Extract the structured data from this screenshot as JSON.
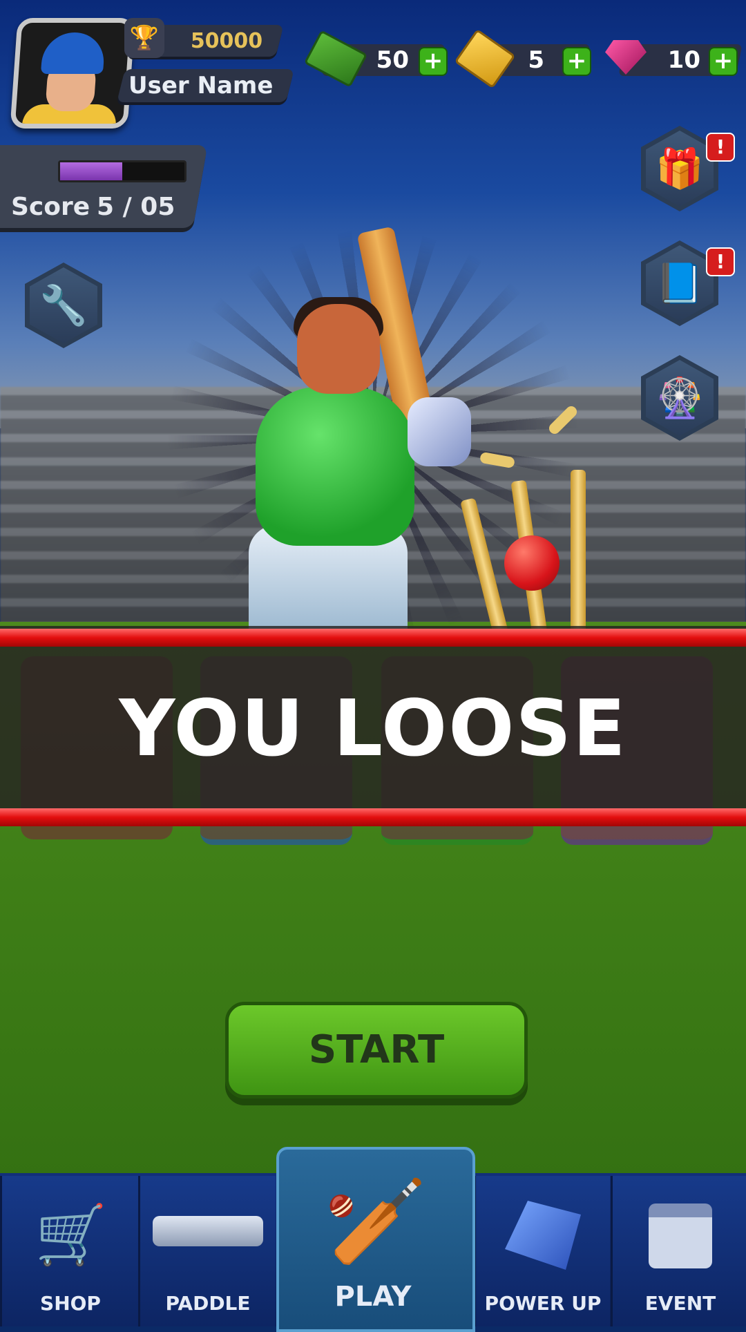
{
  "header": {
    "trophy_score": "50000",
    "user_name": "User Name"
  },
  "currencies": [
    {
      "name": "cash",
      "value": "50"
    },
    {
      "name": "tickets",
      "value": "5"
    },
    {
      "name": "gems",
      "value": "10"
    }
  ],
  "plus_symbol": "+",
  "score_panel": {
    "label": "Score",
    "value": "5 / 05",
    "progress_fraction": 0.5
  },
  "side_buttons": {
    "badge_text": "!"
  },
  "banner": {
    "text": "YOU LOOSE"
  },
  "start_button": {
    "label": "START"
  },
  "nav": {
    "shop": "SHOP",
    "paddle": "PADDLE",
    "play": "PLAY",
    "power_up": "POWER UP",
    "event": "EVENT"
  },
  "colors": {
    "banner_stripe": "#e30e0e",
    "start_button": "#4fa81c",
    "plus_button": "#3db21a",
    "progress_fill": "#9a4fd0"
  },
  "icons": {
    "trophy": "trophy-icon",
    "cash": "cash-icon",
    "ticket": "ticket-icon",
    "gem": "gem-icon",
    "settings": "wrench-icon",
    "gift": "gift-icon",
    "book": "book-icon",
    "wheel": "spin-wheel-icon",
    "shop": "cart-icon",
    "paddle": "grip-icon",
    "play": "crossed-bats-icon",
    "power_up": "crystal-icon",
    "event": "calendar-icon"
  }
}
